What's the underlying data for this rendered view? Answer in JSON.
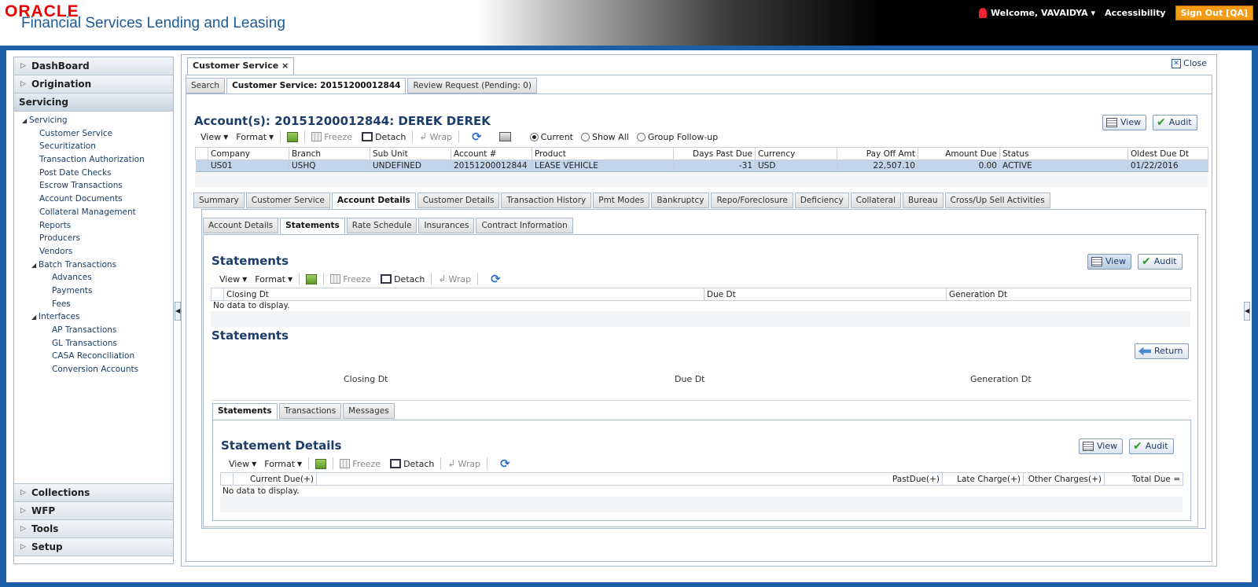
{
  "header": {
    "logo": "ORACLE",
    "product": "Financial Services Lending and Leasing",
    "welcome": "Welcome, VAVAIDYA",
    "accessibility": "Accessibility",
    "signout": "Sign Out [QA]"
  },
  "sidebar": {
    "dashboard": "DashBoard",
    "origination": "Origination",
    "servicing": "Servicing",
    "tree_root": "Servicing",
    "items": [
      "Customer Service",
      "Securitization",
      "Transaction Authorization",
      "Post Date Checks",
      "Escrow Transactions",
      "Account Documents",
      "Collateral Management",
      "Reports",
      "Producers",
      "Vendors"
    ],
    "batch": "Batch Transactions",
    "batch_items": [
      "Advances",
      "Payments",
      "Fees"
    ],
    "interfaces": "Interfaces",
    "interface_items": [
      "AP Transactions",
      "GL Transactions",
      "CASA Reconciliation",
      "Conversion Accounts"
    ],
    "collections": "Collections",
    "wfp": "WFP",
    "tools": "Tools",
    "setup": "Setup"
  },
  "main_tab": "Customer Service",
  "close": "Close",
  "sub_tabs": [
    "Search",
    "Customer Service: 20151200012844",
    "Review Request (Pending: 0)"
  ],
  "account": {
    "title": "Account(s): 20151200012844: DEREK DEREK",
    "view": "View",
    "audit": "Audit",
    "toolbar": {
      "view": "View",
      "format": "Format",
      "freeze": "Freeze",
      "detach": "Detach",
      "wrap": "Wrap"
    },
    "radios": [
      "Current",
      "Show All",
      "Group Follow-up"
    ],
    "columns": [
      "Company",
      "Branch",
      "Sub Unit",
      "Account #",
      "Product",
      "Days Past Due",
      "Currency",
      "Pay Off Amt",
      "Amount Due",
      "Status",
      "Oldest Due Dt"
    ],
    "row": [
      "US01",
      "USHQ",
      "UNDEFINED",
      "20151200012844",
      "LEASE VEHICLE",
      "-31",
      "USD",
      "22,507.10",
      "0.00",
      "ACTIVE",
      "01/22/2016"
    ]
  },
  "detail_tabs": [
    "Summary",
    "Customer Service",
    "Account Details",
    "Customer Details",
    "Transaction History",
    "Pmt Modes",
    "Bankruptcy",
    "Repo/Foreclosure",
    "Deficiency",
    "Collateral",
    "Bureau",
    "Cross/Up Sell Activities"
  ],
  "account_tabs": [
    "Account Details",
    "Statements",
    "Rate Schedule",
    "Insurances",
    "Contract Information"
  ],
  "statements": {
    "title": "Statements",
    "view": "View",
    "audit": "Audit",
    "toolbar": {
      "view": "View",
      "format": "Format",
      "freeze": "Freeze",
      "detach": "Detach",
      "wrap": "Wrap"
    },
    "columns": [
      "Closing Dt",
      "Due Dt",
      "Generation Dt"
    ],
    "nodata": "No data to display.",
    "detail_title": "Statements",
    "return": "Return",
    "labels": [
      "Closing Dt",
      "Due Dt",
      "Generation Dt"
    ]
  },
  "bottom_tabs": [
    "Statements",
    "Transactions",
    "Messages"
  ],
  "statement_details": {
    "title": "Statement Details",
    "view": "View",
    "audit": "Audit",
    "toolbar": {
      "view": "View",
      "format": "Format",
      "freeze": "Freeze",
      "detach": "Detach",
      "wrap": "Wrap"
    },
    "columns": [
      "Current Due(+)",
      "PastDue(+)",
      "Late Charge(+)",
      "Other Charges(+)",
      "Total Due ="
    ],
    "nodata": "No data to display."
  }
}
